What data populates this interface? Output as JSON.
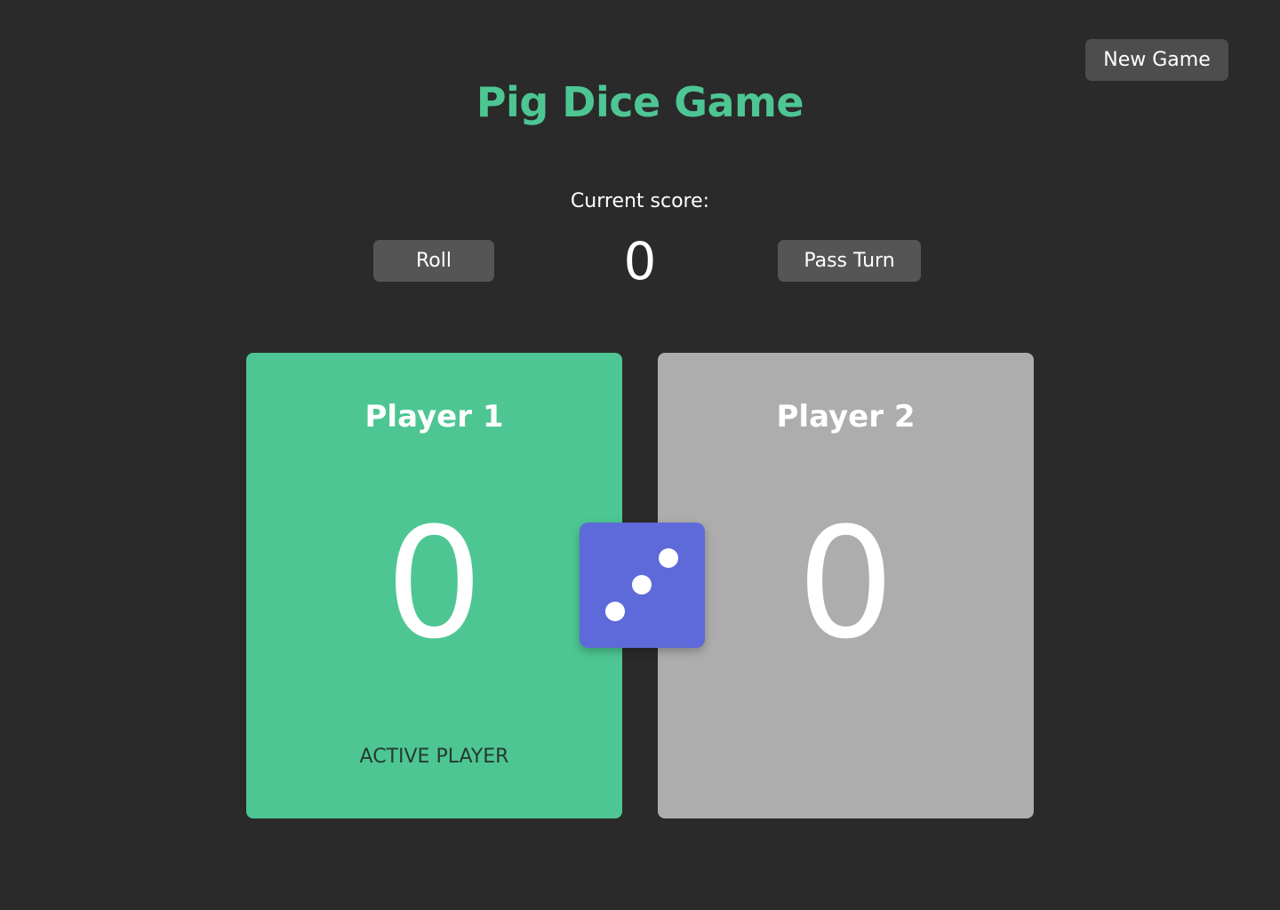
{
  "header": {
    "new_game_label": "New Game",
    "title": "Pig Dice Game"
  },
  "turn": {
    "current_score_label": "Current score:",
    "current_score_value": "0",
    "roll_label": "Roll",
    "pass_label": "Pass Turn"
  },
  "players": [
    {
      "name": "Player 1",
      "score": "0",
      "status": "ACTIVE PLAYER",
      "active": true,
      "color": "#4dc693"
    },
    {
      "name": "Player 2",
      "score": "0",
      "status": "",
      "active": false,
      "color": "#adadad"
    }
  ],
  "die": {
    "value": 3,
    "color": "#5e6ad9",
    "icon": "die-face-three-icon"
  },
  "colors": {
    "background": "#2a2a2a",
    "accent": "#4dc693",
    "button": "#555555"
  }
}
